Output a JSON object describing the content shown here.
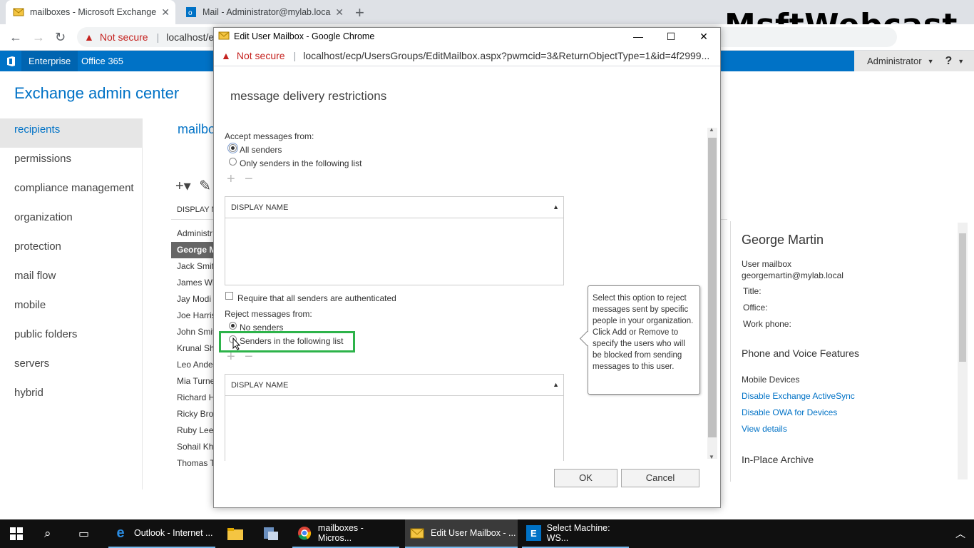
{
  "browser": {
    "tabs": [
      {
        "label": "mailboxes - Microsoft Exchange"
      },
      {
        "label": "Mail - Administrator@mylab.loca"
      }
    ],
    "not_secure": "Not secure",
    "url": "localhost/ec"
  },
  "watermark": "MsftWebcast",
  "suitebar": {
    "enterprise": "Enterprise",
    "office365": "Office 365",
    "user": "Administrator",
    "help": "?"
  },
  "eac": {
    "title": "Exchange admin center",
    "nav": [
      "recipients",
      "permissions",
      "compliance management",
      "organization",
      "protection",
      "mail flow",
      "mobile",
      "public folders",
      "servers",
      "hybrid"
    ],
    "list_title": "mailbo",
    "list_header": "DISPLAY N",
    "rows": [
      "Administr",
      "George M",
      "Jack Smith",
      "James Wh",
      "Jay Modi",
      "Joe Harris",
      "John Smit",
      "Krunal Sh",
      "Leo Ande",
      "Mia Turne",
      "Richard H",
      "Ricky Brow",
      "Ruby Lee",
      "Sohail Kha",
      "Thomas T"
    ]
  },
  "detail": {
    "name": "George Martin",
    "type": "User mailbox",
    "email": "georgemartin@mylab.local",
    "title_label": "Title:",
    "office_label": "Office:",
    "phone_label": "Work phone:",
    "phone_voice": "Phone and Voice Features",
    "mobile_devices": "Mobile Devices",
    "link1": "Disable Exchange ActiveSync",
    "link2": "Disable OWA for Devices",
    "link3": "View details",
    "archive": "In-Place Archive"
  },
  "popup": {
    "window_title": "Edit User Mailbox - Google Chrome",
    "not_secure": "Not secure",
    "url": "localhost/ecp/UsersGroups/EditMailbox.aspx?pwmcid=3&ReturnObjectType=1&id=4f2999...",
    "heading": "message delivery restrictions",
    "accept_label": "Accept messages from:",
    "all_senders": "All senders",
    "only_senders": "Only senders in the following list",
    "display_name_header": "DISPLAY NAME",
    "require_auth": "Require that all senders are authenticated",
    "reject_label": "Reject messages from:",
    "no_senders": "No senders",
    "senders_list": "Senders in the following list",
    "tooltip": "Select this option to reject messages sent by specific people in your organization. Click Add or Remove to specify the users who will be blocked from sending messages to this user.",
    "ok": "OK",
    "cancel": "Cancel"
  },
  "taskbar": {
    "apps": [
      {
        "label": "Outlook - Internet ..."
      },
      {
        "label": "mailboxes - Micros..."
      },
      {
        "label": "Edit User Mailbox - ..."
      },
      {
        "label": "Select Machine: WS..."
      }
    ]
  }
}
